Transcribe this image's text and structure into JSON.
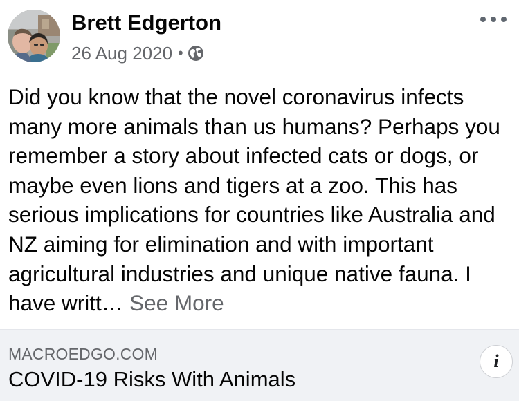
{
  "post": {
    "author": "Brett Edgerton",
    "date": "26 Aug 2020",
    "separator": "•",
    "audience_icon": "globe-icon",
    "more_icon": "more-options-icon",
    "body": "Did you know that the novel coronavirus infects many more animals than us humans? Perhaps you remember a story about infected cats or dogs, or maybe even lions and tigers at a zoo. This has serious implications for countries like Australia and NZ aiming for elimination and with important agricultural industries and unique native fauna. I have writt…",
    "see_more": " See More"
  },
  "link_preview": {
    "domain": "MACROEDGO.COM",
    "title": "COVID-19 Risks With Animals",
    "info_icon": "info-icon",
    "info_glyph": "i"
  },
  "colors": {
    "text_primary": "#050505",
    "text_secondary": "#65676b",
    "card_background": "#f0f2f5"
  }
}
